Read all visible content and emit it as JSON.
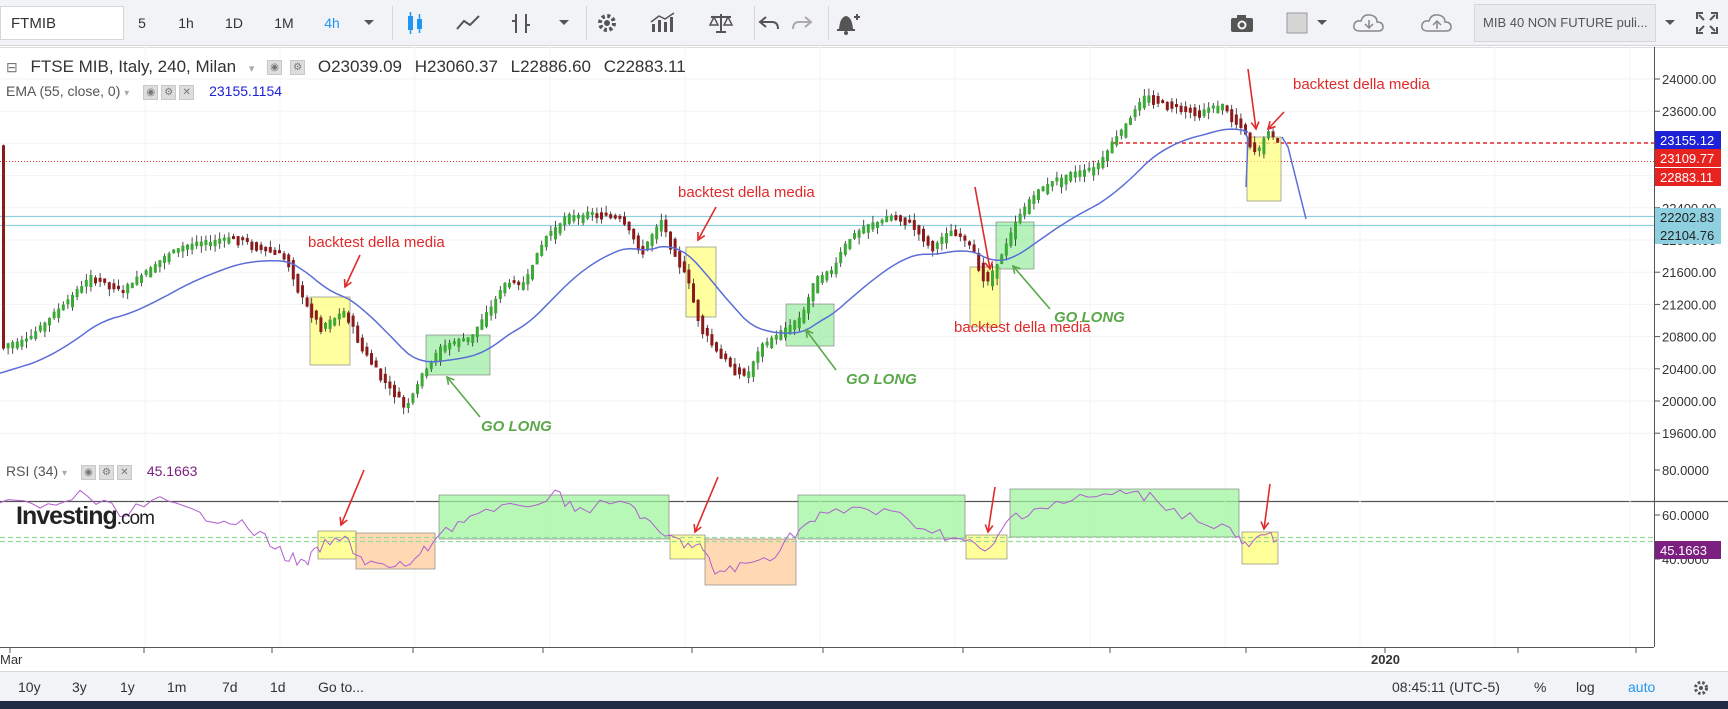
{
  "toolbar": {
    "symbol": "FTMIB",
    "intervals": [
      "5",
      "1h",
      "1D",
      "1M",
      "4h"
    ],
    "active_interval": "4h",
    "search_value": "MIB 40 NON FUTURE puli..."
  },
  "legend": {
    "main_title": "FTSE MIB, Italy, 240, Milan",
    "open": "O23039.09",
    "high": "H23060.37",
    "low": "L22886.60",
    "close": "C22883.11",
    "ema_label": "EMA (55, close, 0)",
    "ema_value": "23155.1154",
    "rsi_label": "RSI (34)",
    "rsi_value": "45.1663"
  },
  "price_axis": [
    "24000.00",
    "23600.00",
    "23200.00",
    "22800.00",
    "22400.00",
    "22000.00",
    "21600.00",
    "21200.00",
    "20800.00",
    "20400.00",
    "20000.00",
    "19600.00"
  ],
  "price_tags": [
    {
      "value": "23155.12",
      "color": "#1e22d6"
    },
    {
      "value": "23109.77",
      "color": "#e8231f"
    },
    {
      "value": "22883.11",
      "color": "#e8231f"
    },
    {
      "value": "22202.83",
      "color": "#8fd0e0"
    },
    {
      "value": "22104.76",
      "color": "#8fd0e0"
    }
  ],
  "rsi_axis": [
    "80.0000",
    "60.0000",
    "40.0000"
  ],
  "rsi_tag": {
    "value": "45.1663",
    "color": "#7b1f80"
  },
  "time_axis": {
    "left": "Mar",
    "right": "2020"
  },
  "annotations": {
    "backtest": "backtest della media",
    "go_long": "GO LONG"
  },
  "logo": {
    "main": "Investing",
    "suffix": ".com"
  },
  "bottombar": {
    "ranges": [
      "10y",
      "3y",
      "1y",
      "1m",
      "7d",
      "1d"
    ],
    "goto": "Go to...",
    "time": "08:45:11 (UTC-5)",
    "percent": "%",
    "log": "log",
    "auto": "auto"
  },
  "colors": {
    "up": "#3aa935",
    "down": "#8b1a1a",
    "ema": "#5b6ed8",
    "rsi": "#b05ed0",
    "annotation": "#e02a2a",
    "golong": "#5aa84a"
  }
}
